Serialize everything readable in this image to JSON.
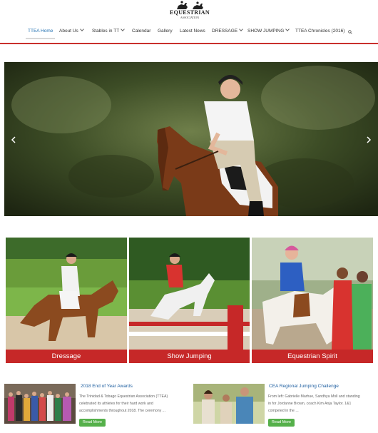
{
  "logo": {
    "word": "EQUESTRIAN",
    "sub": "ASSOCIATION"
  },
  "nav": {
    "items": [
      {
        "label": "TTEA Home",
        "dropdown": false,
        "active": true
      },
      {
        "label": "About Us",
        "dropdown": true
      },
      {
        "label": "Stables in TT",
        "dropdown": true
      },
      {
        "label": "Calendar",
        "dropdown": false
      },
      {
        "label": "Gallery",
        "dropdown": false
      },
      {
        "label": "Latest News",
        "dropdown": false
      },
      {
        "label": "DRESSAGE",
        "dropdown": true
      },
      {
        "label": "SHOW JUMPING",
        "dropdown": true
      },
      {
        "label": "TTEA Chronicles (2016)",
        "dropdown": false
      }
    ],
    "search_icon": "search-icon"
  },
  "hero": {
    "left_arrow": "chevron-left-icon",
    "right_arrow": "chevron-right-icon"
  },
  "tiles": [
    {
      "label": "Dressage"
    },
    {
      "label": "Show Jumping"
    },
    {
      "label": "Equestrian Spirit"
    }
  ],
  "news": [
    {
      "title": "2018 End of Year Awards",
      "lines": [
        "The Trinidad & Tobago Equestrian Association (TTEA)",
        "celebrated its athletes for their hard work and",
        "accomplishments throughout 2018. The ceremony ..."
      ],
      "button": "Read More"
    },
    {
      "title": "CEA Regional Jumping Challenge",
      "lines": [
        "From left: Gabrielle Marhue, Sandhya Moll and standing",
        "in for Jordanne Brown, coach Kim Anja Taylor. 1&1",
        "competed in the ..."
      ],
      "button": "Read More"
    }
  ],
  "colors": {
    "accent_red": "#c62828",
    "link_blue": "#1f5fa0",
    "button_green": "#55b04a"
  }
}
